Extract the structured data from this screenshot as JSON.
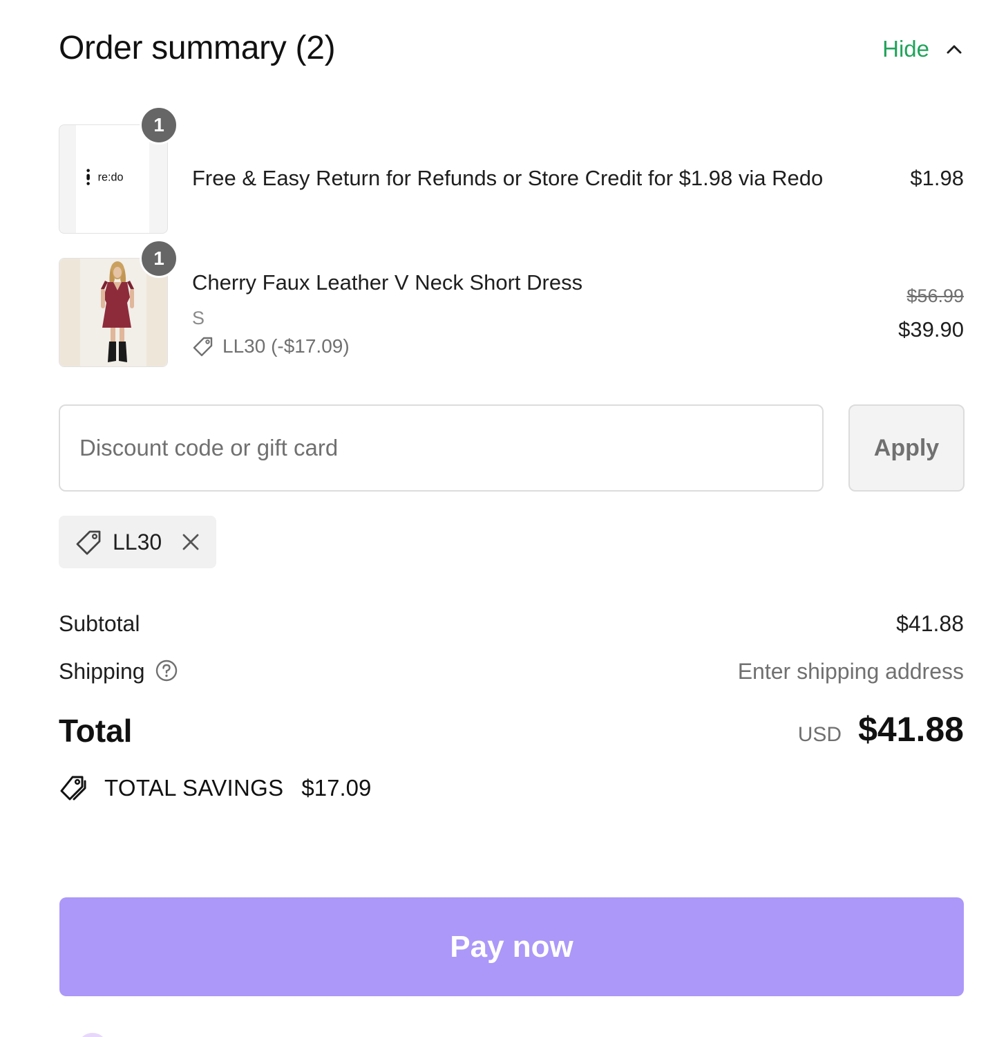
{
  "header": {
    "title": "Order summary (2)",
    "toggle_label": "Hide"
  },
  "items": [
    {
      "quantity": "1",
      "name": "Free & Easy Return for Refunds or Store Credit for $1.98 via Redo",
      "price": "$1.98",
      "logo_text": "re:do"
    },
    {
      "quantity": "1",
      "name": "Cherry Faux Leather V Neck Short Dress",
      "variant": "S",
      "discount": "LL30 (-$17.09)",
      "original_price": "$56.99",
      "price": "$39.90"
    }
  ],
  "discount_form": {
    "placeholder": "Discount code or gift card",
    "value": "",
    "apply_label": "Apply"
  },
  "applied_code": {
    "label": "LL30"
  },
  "summary": {
    "subtotal_label": "Subtotal",
    "subtotal_value": "$41.88",
    "shipping_label": "Shipping",
    "shipping_value": "Enter shipping address",
    "total_label": "Total",
    "currency": "USD",
    "total_value": "$41.88",
    "savings_label": "TOTAL SAVINGS",
    "savings_value": "$17.09"
  },
  "pay_button": {
    "label": "Pay now",
    "color": "#ab98f8"
  },
  "colors": {
    "accent_green": "#21a35b",
    "badge_gray": "#666666"
  }
}
